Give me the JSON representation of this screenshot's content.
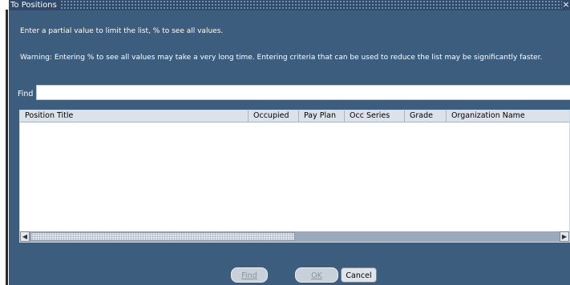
{
  "window": {
    "title": "To Positions",
    "close_glyph": "×"
  },
  "messages": {
    "hint": "Enter a partial value to limit the list, % to see all values.",
    "warning": "Warning: Entering % to see all values may take a very long time. Entering criteria that can be used to reduce the list may be significantly faster."
  },
  "find": {
    "label": "Find",
    "value": ""
  },
  "table": {
    "columns": [
      "Position Title",
      "Occupied",
      "Pay Plan",
      "Occ Series",
      "Grade",
      "Organization Name"
    ],
    "rows": []
  },
  "buttons": {
    "find": {
      "label": "Find",
      "enabled": false
    },
    "ok": {
      "label": "OK",
      "enabled": false
    },
    "cancel": {
      "label": "Cancel",
      "enabled": true
    }
  },
  "scrollbar": {
    "left_arrow_icon": "arrow-left-icon",
    "right_arrow_icon": "arrow-right-icon"
  },
  "colors": {
    "dialog_bg": "#3d5d7f",
    "titlebar": "#2f4a6a",
    "header": "#dce2ea"
  }
}
